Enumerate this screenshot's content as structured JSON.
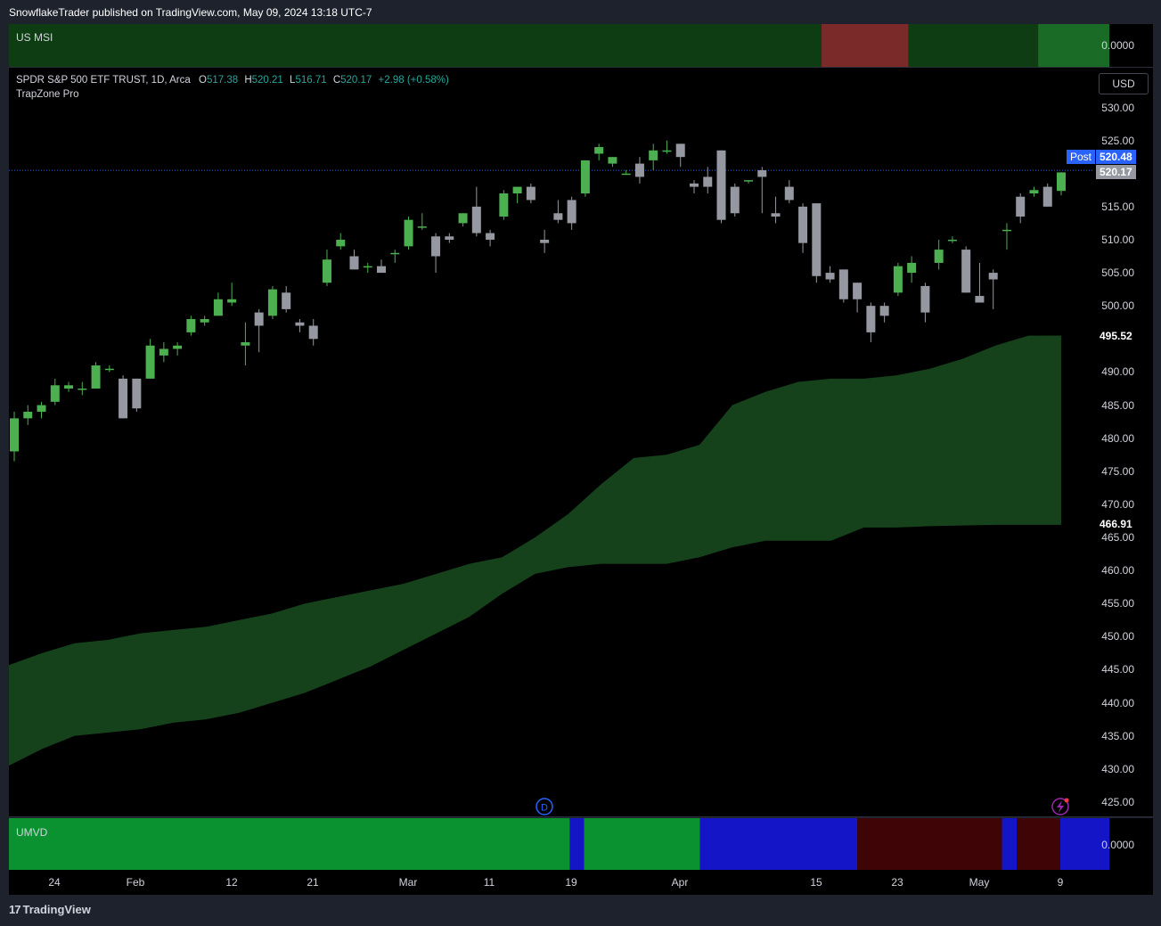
{
  "header": {
    "publish_text": "SnowflakeTrader published on TradingView.com, May 09, 2024 13:18 UTC-7"
  },
  "legend": {
    "symbol": "SPDR S&P 500 ETF TRUST, 1D, Arca",
    "o_label": "O",
    "o": "517.38",
    "h_label": "H",
    "h": "520.21",
    "l_label": "L",
    "l": "516.71",
    "c_label": "C",
    "c": "520.17",
    "change": "+2.98 (+0.58%)",
    "indicator": "TrapZone Pro"
  },
  "msi_pane": {
    "label": "US MSI",
    "value": "0.0000"
  },
  "umvd_pane": {
    "label": "UMVD",
    "value": "0.0000"
  },
  "currency": "USD",
  "badges": {
    "post_label": "Post",
    "post_value": "520.48",
    "last_value": "520.17",
    "zone_top": "495.52",
    "zone_bottom": "466.91"
  },
  "footer": {
    "brand": "TradingView",
    "logo": "17"
  },
  "colors": {
    "bull": "#4caf50",
    "bear": "#9598a1",
    "cloud": "#15421b",
    "msi_dark_green": "#0f3d13",
    "msi_red": "#7b2a2a",
    "msi_green": "#1a6b26",
    "umvd_green": "#0a9130",
    "umvd_blue": "#1515c8",
    "umvd_red": "#3f0506",
    "post_badge": "#2962ff"
  },
  "chart_data": {
    "type": "candlestick",
    "title": "SPDR S&P 500 ETF TRUST, 1D, Arca",
    "y_ticks": [
      "530.00",
      "525.00",
      "515.00",
      "510.00",
      "505.00",
      "500.00",
      "490.00",
      "485.00",
      "480.00",
      "475.00",
      "470.00",
      "465.00",
      "460.00",
      "455.00",
      "450.00",
      "445.00",
      "440.00",
      "435.00",
      "430.00",
      "425.00"
    ],
    "x_ticks": [
      "24",
      "Feb",
      "12",
      "21",
      "Mar",
      "11",
      "19",
      "Apr",
      "15",
      "23",
      "May",
      "9"
    ],
    "ylim": [
      422.5,
      535.5
    ],
    "candles": [
      {
        "o": 478.0,
        "h": 484.0,
        "l": 476.5,
        "c": 483.0
      },
      {
        "o": 483.0,
        "h": 485.0,
        "l": 482.0,
        "c": 484.0
      },
      {
        "o": 484.0,
        "h": 485.5,
        "l": 483.0,
        "c": 485.0
      },
      {
        "o": 485.5,
        "h": 489.0,
        "l": 485.0,
        "c": 488.0
      },
      {
        "o": 487.5,
        "h": 488.5,
        "l": 487.0,
        "c": 488.0
      },
      {
        "o": 487.5,
        "h": 488.5,
        "l": 486.5,
        "c": 487.5
      },
      {
        "o": 487.5,
        "h": 491.5,
        "l": 487.5,
        "c": 491.0
      },
      {
        "o": 490.5,
        "h": 491.0,
        "l": 490.0,
        "c": 490.5
      },
      {
        "o": 489.0,
        "h": 489.5,
        "l": 483.0,
        "c": 483.0
      },
      {
        "o": 489.0,
        "h": 489.0,
        "l": 484.0,
        "c": 484.5
      },
      {
        "o": 489.0,
        "h": 495.0,
        "l": 489.0,
        "c": 494.0
      },
      {
        "o": 492.5,
        "h": 494.5,
        "l": 491.5,
        "c": 493.5
      },
      {
        "o": 493.5,
        "h": 494.5,
        "l": 492.5,
        "c": 494.0
      },
      {
        "o": 496.0,
        "h": 498.5,
        "l": 495.5,
        "c": 498.0
      },
      {
        "o": 497.5,
        "h": 498.5,
        "l": 497.0,
        "c": 498.0
      },
      {
        "o": 498.5,
        "h": 502.0,
        "l": 498.5,
        "c": 501.0
      },
      {
        "o": 500.5,
        "h": 503.5,
        "l": 500.0,
        "c": 501.0
      },
      {
        "o": 494.0,
        "h": 497.5,
        "l": 491.0,
        "c": 494.5
      },
      {
        "o": 499.0,
        "h": 499.5,
        "l": 493.0,
        "c": 497.0
      },
      {
        "o": 498.5,
        "h": 503.0,
        "l": 498.0,
        "c": 502.5
      },
      {
        "o": 502.0,
        "h": 503.0,
        "l": 499.0,
        "c": 499.5
      },
      {
        "o": 497.5,
        "h": 498.0,
        "l": 496.0,
        "c": 497.0
      },
      {
        "o": 497.0,
        "h": 498.0,
        "l": 494.0,
        "c": 495.0
      },
      {
        "o": 503.5,
        "h": 508.5,
        "l": 503.0,
        "c": 507.0
      },
      {
        "o": 509.0,
        "h": 511.0,
        "l": 508.5,
        "c": 510.0
      },
      {
        "o": 507.5,
        "h": 508.5,
        "l": 505.5,
        "c": 505.5
      },
      {
        "o": 506.0,
        "h": 506.5,
        "l": 505.0,
        "c": 506.0
      },
      {
        "o": 506.0,
        "h": 507.0,
        "l": 505.0,
        "c": 505.0
      },
      {
        "o": 508.0,
        "h": 508.5,
        "l": 506.5,
        "c": 508.0
      },
      {
        "o": 509.0,
        "h": 513.5,
        "l": 508.5,
        "c": 513.0
      },
      {
        "o": 512.0,
        "h": 514.0,
        "l": 511.5,
        "c": 512.0
      },
      {
        "o": 510.5,
        "h": 511.0,
        "l": 505.0,
        "c": 507.5
      },
      {
        "o": 510.5,
        "h": 511.0,
        "l": 509.5,
        "c": 510.0
      },
      {
        "o": 512.5,
        "h": 514.0,
        "l": 512.0,
        "c": 514.0
      },
      {
        "o": 515.0,
        "h": 518.0,
        "l": 510.5,
        "c": 511.0
      },
      {
        "o": 511.0,
        "h": 511.5,
        "l": 509.0,
        "c": 510.0
      },
      {
        "o": 513.5,
        "h": 517.5,
        "l": 513.0,
        "c": 517.0
      },
      {
        "o": 517.0,
        "h": 518.0,
        "l": 515.5,
        "c": 518.0
      },
      {
        "o": 518.0,
        "h": 518.5,
        "l": 515.5,
        "c": 516.0
      },
      {
        "o": 510.0,
        "h": 511.5,
        "l": 508.0,
        "c": 509.5
      },
      {
        "o": 514.0,
        "h": 516.0,
        "l": 512.5,
        "c": 513.0
      },
      {
        "o": 516.0,
        "h": 516.5,
        "l": 511.5,
        "c": 512.5
      },
      {
        "o": 517.0,
        "h": 522.0,
        "l": 516.5,
        "c": 522.0
      },
      {
        "o": 523.0,
        "h": 524.5,
        "l": 522.0,
        "c": 524.0
      },
      {
        "o": 521.5,
        "h": 522.5,
        "l": 521.0,
        "c": 522.5
      },
      {
        "o": 520.0,
        "h": 520.5,
        "l": 520.0,
        "c": 520.0
      },
      {
        "o": 521.5,
        "h": 522.5,
        "l": 518.5,
        "c": 519.5
      },
      {
        "o": 522.0,
        "h": 524.5,
        "l": 520.5,
        "c": 523.5
      },
      {
        "o": 523.5,
        "h": 525.0,
        "l": 523.0,
        "c": 523.5
      },
      {
        "o": 524.5,
        "h": 524.5,
        "l": 521.0,
        "c": 522.5
      },
      {
        "o": 518.5,
        "h": 519.0,
        "l": 517.0,
        "c": 518.0
      },
      {
        "o": 519.5,
        "h": 521.0,
        "l": 517.0,
        "c": 518.0
      },
      {
        "o": 523.5,
        "h": 523.5,
        "l": 512.5,
        "c": 513.0
      },
      {
        "o": 518.0,
        "h": 518.5,
        "l": 513.5,
        "c": 514.0
      },
      {
        "o": 519.0,
        "h": 519.0,
        "l": 518.5,
        "c": 519.0
      },
      {
        "o": 520.5,
        "h": 521.0,
        "l": 514.0,
        "c": 519.5
      },
      {
        "o": 514.0,
        "h": 516.5,
        "l": 512.5,
        "c": 513.5
      },
      {
        "o": 518.0,
        "h": 519.0,
        "l": 515.5,
        "c": 516.0
      },
      {
        "o": 515.0,
        "h": 515.5,
        "l": 508.0,
        "c": 509.5
      },
      {
        "o": 515.5,
        "h": 515.5,
        "l": 503.5,
        "c": 504.5
      },
      {
        "o": 505.0,
        "h": 506.0,
        "l": 503.5,
        "c": 504.0
      },
      {
        "o": 505.5,
        "h": 505.5,
        "l": 500.5,
        "c": 501.0
      },
      {
        "o": 503.5,
        "h": 503.5,
        "l": 499.0,
        "c": 501.0
      },
      {
        "o": 500.0,
        "h": 500.5,
        "l": 494.5,
        "c": 496.0
      },
      {
        "o": 500.0,
        "h": 500.5,
        "l": 497.5,
        "c": 498.5
      },
      {
        "o": 502.0,
        "h": 506.5,
        "l": 501.5,
        "c": 506.0
      },
      {
        "o": 505.0,
        "h": 507.5,
        "l": 503.5,
        "c": 506.5
      },
      {
        "o": 503.0,
        "h": 503.5,
        "l": 497.5,
        "c": 499.0
      },
      {
        "o": 506.5,
        "h": 510.0,
        "l": 505.5,
        "c": 508.5
      },
      {
        "o": 510.0,
        "h": 510.5,
        "l": 509.5,
        "c": 510.0
      },
      {
        "o": 508.5,
        "h": 509.0,
        "l": 502.0,
        "c": 502.0
      },
      {
        "o": 501.5,
        "h": 506.5,
        "l": 500.5,
        "c": 500.5
      },
      {
        "o": 505.0,
        "h": 505.5,
        "l": 499.5,
        "c": 504.0
      },
      {
        "o": 511.5,
        "h": 512.5,
        "l": 508.5,
        "c": 511.5
      },
      {
        "o": 516.5,
        "h": 517.0,
        "l": 512.5,
        "c": 513.5
      },
      {
        "o": 517.0,
        "h": 518.0,
        "l": 516.5,
        "c": 517.5
      },
      {
        "o": 518.0,
        "h": 518.5,
        "l": 515.0,
        "c": 515.0
      },
      {
        "o": 517.38,
        "h": 520.21,
        "l": 516.71,
        "c": 520.17
      }
    ],
    "cloud": {
      "upper": [
        445.7,
        447.5,
        449.0,
        449.5,
        450.5,
        451.0,
        451.5,
        452.5,
        453.5,
        455.0,
        456.0,
        457.0,
        458.0,
        459.5,
        461.0,
        462.0,
        465.0,
        468.5,
        473.0,
        477.0,
        477.5,
        479.0,
        485.0,
        487.0,
        488.5,
        489.0,
        489.0,
        489.5,
        490.5,
        492.0,
        494.0,
        495.5,
        495.52
      ],
      "lower": [
        430.5,
        433.0,
        435.0,
        435.5,
        436.0,
        437.0,
        437.5,
        438.5,
        440.0,
        441.5,
        443.5,
        445.5,
        448.0,
        450.5,
        453.0,
        456.5,
        459.5,
        460.5,
        461.0,
        461.0,
        461.0,
        462.0,
        463.5,
        464.5,
        464.5,
        464.5,
        466.5,
        466.5,
        466.7,
        466.8,
        466.9,
        466.91,
        466.91
      ]
    },
    "post_price": 520.48,
    "last_price": 520.17
  },
  "msi_segments": [
    {
      "from": 0.0,
      "to": 0.7103,
      "color": "msi_dark_green"
    },
    {
      "from": 0.7103,
      "to": 0.7863,
      "color": "msi_red"
    },
    {
      "from": 0.7863,
      "to": 0.8996,
      "color": "msi_dark_green"
    },
    {
      "from": 0.8996,
      "to": 0.9619,
      "color": "msi_green"
    }
  ],
  "umvd_segments": [
    {
      "from": 0.0,
      "to": 0.4902,
      "color": "umvd_green"
    },
    {
      "from": 0.4902,
      "to": 0.5027,
      "color": "umvd_blue"
    },
    {
      "from": 0.5027,
      "to": 0.604,
      "color": "umvd_green"
    },
    {
      "from": 0.604,
      "to": 0.7416,
      "color": "umvd_blue"
    },
    {
      "from": 0.7416,
      "to": 0.868,
      "color": "umvd_red"
    },
    {
      "from": 0.868,
      "to": 0.881,
      "color": "umvd_blue"
    },
    {
      "from": 0.881,
      "to": 0.919,
      "color": "umvd_red"
    },
    {
      "from": 0.919,
      "to": 0.9619,
      "color": "umvd_blue"
    }
  ]
}
